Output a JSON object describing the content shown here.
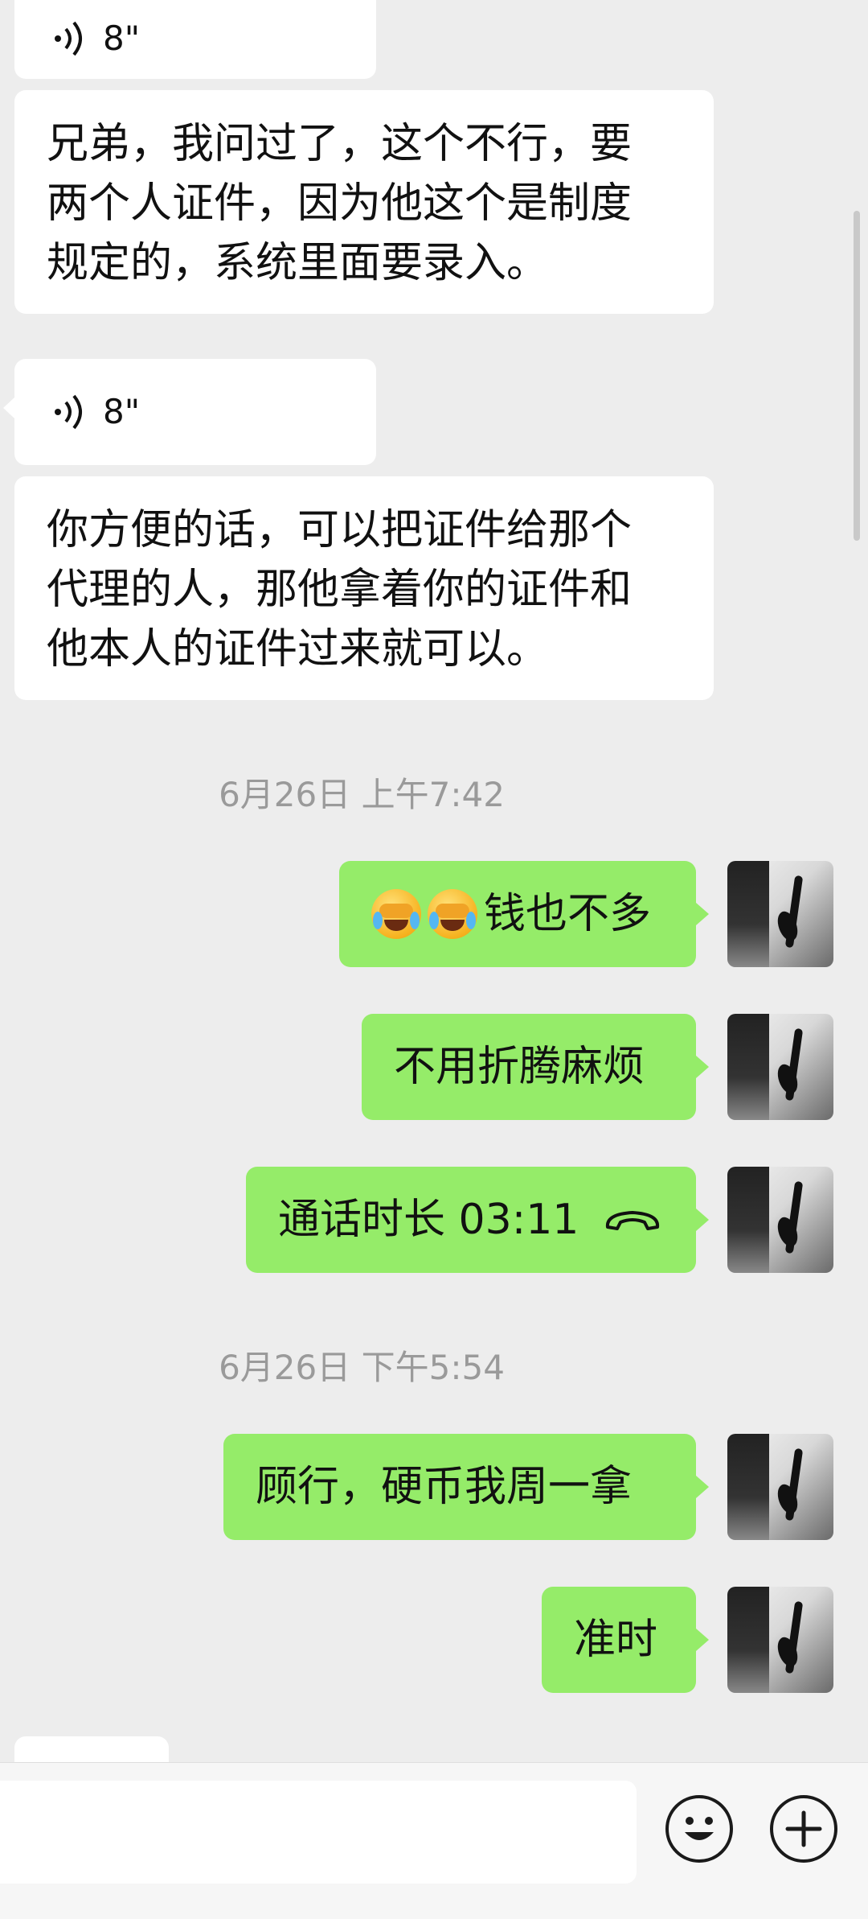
{
  "messages": {
    "top_voice": {
      "duration": "8\""
    },
    "incoming_1": {
      "lines": [
        "兄弟，我问过了，这个不行，要",
        "两个人证件，因为他这个是制度",
        "规定的，系统里面要录入。"
      ]
    },
    "voice_2": {
      "duration": "8\""
    },
    "incoming_2": {
      "lines": [
        "你方便的话，可以把证件给那个",
        "代理的人，那他拿着你的证件和",
        "他本人的证件过来就可以。"
      ]
    },
    "time_1": "6月26日 上午7:42",
    "out_1": "钱也不多",
    "out_2": "不用折腾麻烦",
    "out_3": "通话时长 03:11",
    "time_2": "6月26日 下午5:54",
    "out_4": "顾行，硬币我周一拿",
    "out_5": "准时"
  },
  "icons": {
    "voice": "voice-wave-icon",
    "call": "phone-hangup-icon",
    "emoji_button": "smiley-icon",
    "plus_button": "plus-icon",
    "crying_emoji": "crying-face-emoji"
  },
  "colors": {
    "incoming": "#ffffff",
    "outgoing": "#95ec69",
    "background": "#ededed"
  }
}
